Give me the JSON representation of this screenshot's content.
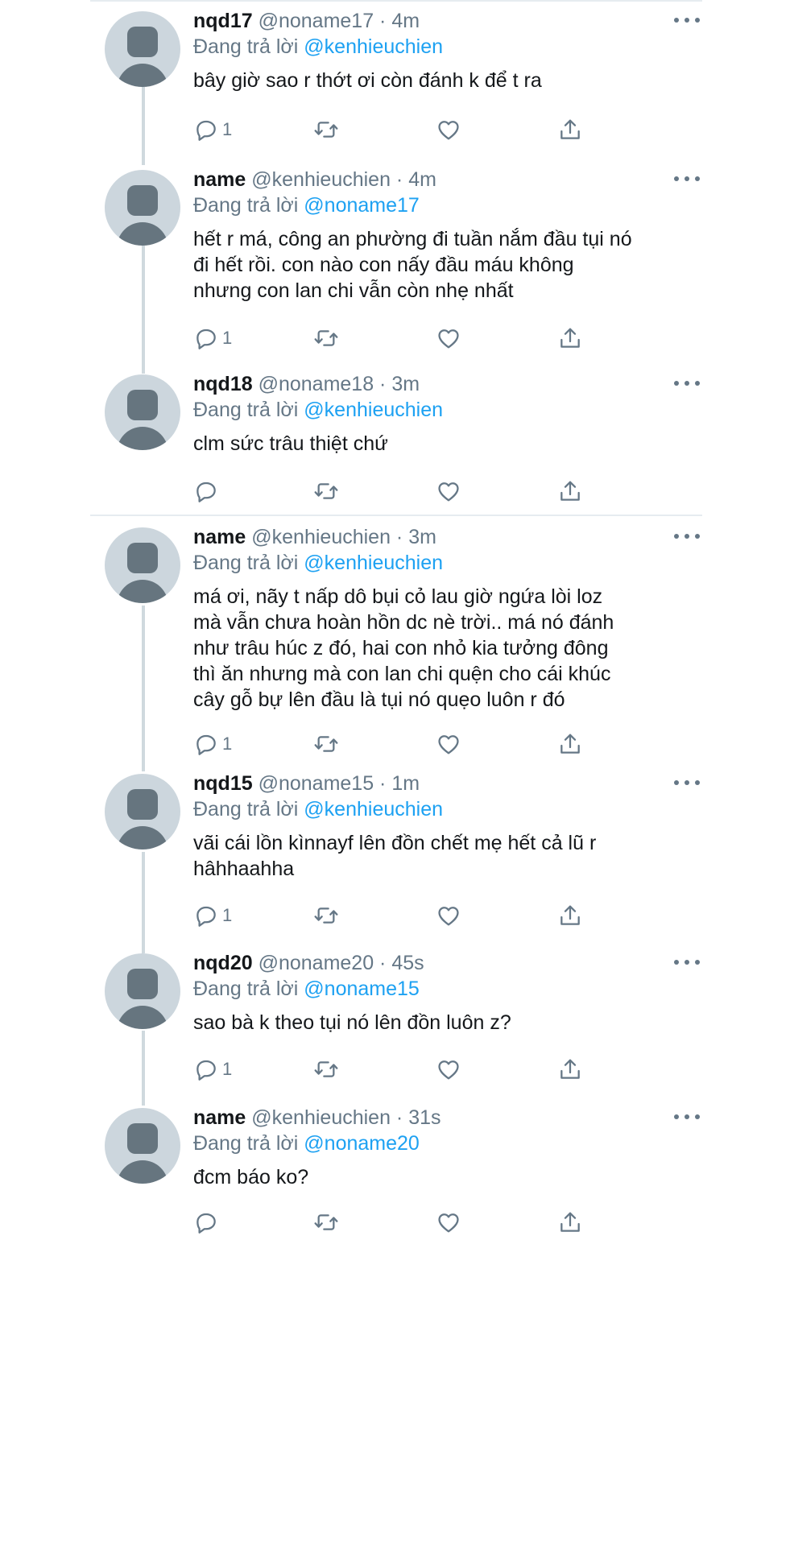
{
  "reply_prefix": "Đang trả lời",
  "tweets": [
    {
      "name": "nqd17",
      "handle_time": "@noname17 · 4m",
      "reply_to": "@kenhieuchien",
      "lines": [
        "bây giờ sao r thớt ơi còn đánh k để t ra"
      ],
      "reply_count": "1"
    },
    {
      "name": "name",
      "handle_time": "@kenhieuchien · 4m",
      "reply_to": "@noname17",
      "lines": [
        "hết r má, công an phường đi tuần nắm đầu tụi nó",
        "đi hết rồi. con nào con nấy đầu máu không",
        "nhưng con lan chi vẫn còn nhẹ nhất"
      ],
      "reply_count": "1"
    },
    {
      "name": "nqd18",
      "handle_time": "@noname18 · 3m",
      "reply_to": "@kenhieuchien",
      "lines": [
        "clm sức trâu thiệt chứ"
      ],
      "reply_count": ""
    },
    {
      "name": "name",
      "handle_time": "@kenhieuchien · 3m",
      "reply_to": "@kenhieuchien",
      "lines": [
        "má ơi, nãy t nấp dô bụi cỏ lau giờ ngứa lòi loz",
        "mà vẫn chưa hoàn hồn dc nè trời.. má nó đánh",
        "như trâu húc z đó, hai con nhỏ kia tưởng đông",
        "thì ăn nhưng mà con lan chi quện cho cái khúc",
        "cây gỗ bự lên đầu là tụi nó quẹo luôn r đó"
      ],
      "reply_count": "1"
    },
    {
      "name": "nqd15",
      "handle_time": "@noname15 · 1m",
      "reply_to": "@kenhieuchien",
      "lines": [
        "vãi cái lồn kìnnayf lên đồn chết mẹ hết cả lũ r",
        "hâhhaahha"
      ],
      "reply_count": "1"
    },
    {
      "name": "nqd20",
      "handle_time": "@noname20 · 45s",
      "reply_to": "@noname15",
      "lines": [
        "sao bà k theo tụi nó lên đồn luôn z?"
      ],
      "reply_count": "1"
    },
    {
      "name": "name",
      "handle_time": "@kenhieuchien · 31s",
      "reply_to": "@noname20",
      "lines": [
        "đcm báo ko?"
      ],
      "reply_count": ""
    }
  ],
  "icons": {
    "reply": "reply-icon",
    "retweet": "retweet-icon",
    "like": "heart-icon",
    "share": "share-icon",
    "more": "more-icon",
    "avatar": "default-avatar-icon"
  },
  "colors": {
    "link": "#1da1f2",
    "secondary": "#657786",
    "primary_text": "#14171a",
    "avatar_bg": "#ccd6dd",
    "avatar_fg": "#66757f",
    "divider": "#e6ecf0"
  }
}
